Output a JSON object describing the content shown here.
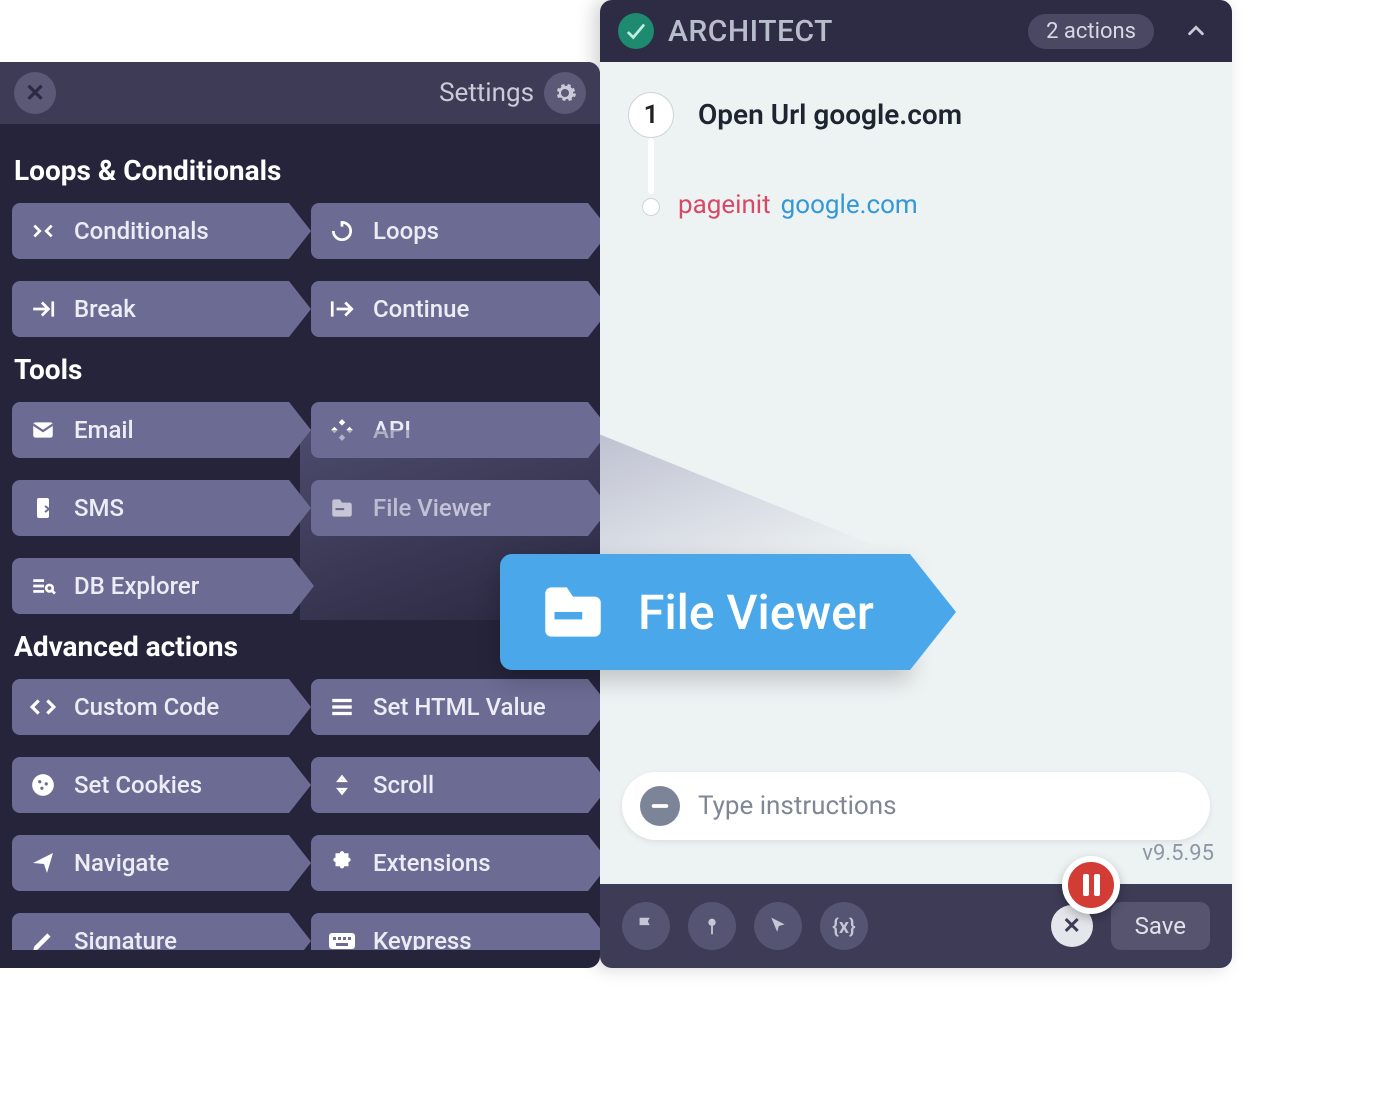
{
  "architect": {
    "title": "ARCHITECT",
    "badge": "2 actions",
    "action1_num": "1",
    "action1_title": "Open Url google.com",
    "action1_kind": "pageinit",
    "action1_url": "google.com",
    "input_placeholder": "Type instructions",
    "version": "v9.5.95",
    "save": "Save"
  },
  "palette": {
    "settings": "Settings",
    "section1": "Loops & Conditionals",
    "s1_items": [
      "Conditionals",
      "Loops",
      "Break",
      "Continue"
    ],
    "section2": "Tools",
    "s2_items": [
      "Email",
      "API",
      "SMS",
      "File Viewer",
      "DB Explorer"
    ],
    "section3": "Advanced actions",
    "s3_items": [
      "Custom Code",
      "Set HTML Value",
      "Set Cookies",
      "Scroll",
      "Navigate",
      "Extensions",
      "Signature",
      "Keypress"
    ]
  },
  "big_chip": "File Viewer",
  "vars_label": "{x}"
}
